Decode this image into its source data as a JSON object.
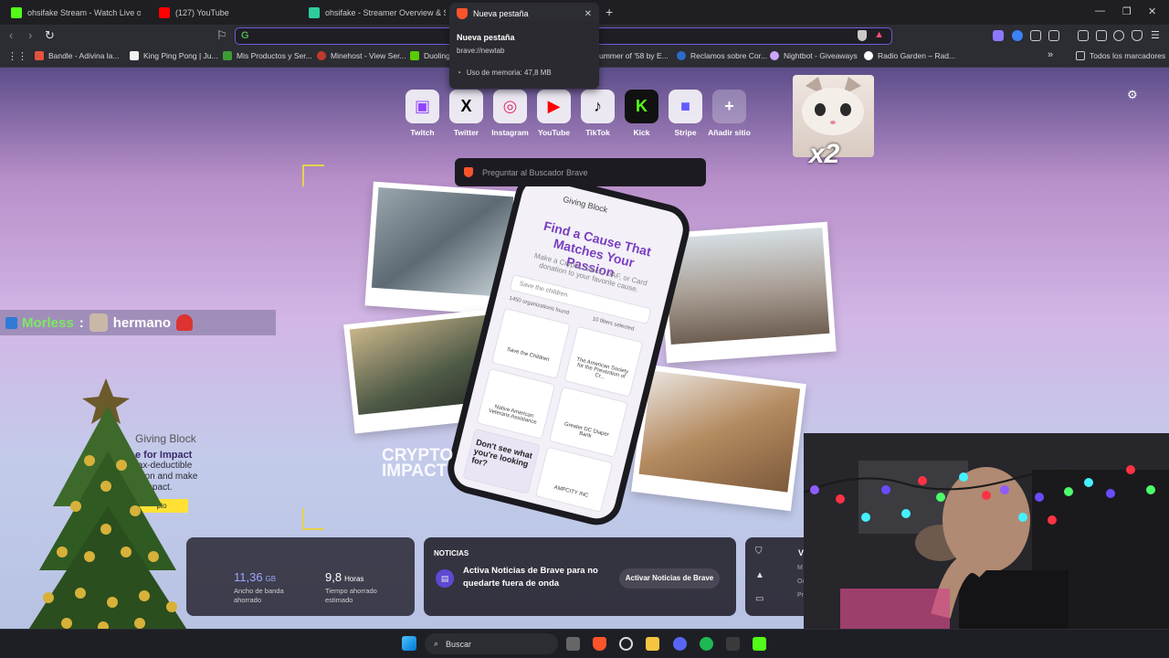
{
  "tabs": [
    {
      "title": "ohsifake Stream - Watch Live on",
      "color": "#53fc18"
    },
    {
      "title": "(127) YouTube",
      "color": "#ff0000"
    },
    {
      "title": "ohsifake - Streamer Overview & Stats",
      "color": "#2fcc9e"
    },
    {
      "title": "Nueva pestaña",
      "color": "#fb542b",
      "active": true
    }
  ],
  "hover_card": {
    "title": "Nueva pestaña",
    "url": "brave://newtab",
    "memory": "Uso de memoria: 47,8 MB"
  },
  "bookmarks": [
    {
      "label": "Bandle - Adivina la...",
      "color": "#e5533c"
    },
    {
      "label": "King Ping Pong | Ju...",
      "color": "#f1f1f1"
    },
    {
      "label": "Mis Productos y Ser...",
      "color": "#3e9b36"
    },
    {
      "label": "Minehost - View Ser...",
      "color": "#c0392b"
    },
    {
      "label": "Duoling",
      "color": "#58cc02"
    },
    {
      "label": "ummer of '58 by E...",
      "color": "#888888"
    },
    {
      "label": "Reclamos sobre Cor...",
      "color": "#2d6ac9"
    },
    {
      "label": "Nightbot - Giveaways",
      "color": "#c9a6ff"
    },
    {
      "label": "Radio Garden – Rad...",
      "color": "#ffffff"
    },
    {
      "label": "Todos los marcadores",
      "color": "#cccccc"
    }
  ],
  "top_sites": [
    {
      "label": "Twitch",
      "glyph": "▣",
      "color": "#9146ff"
    },
    {
      "label": "Twitter",
      "glyph": "X",
      "color": "#000000"
    },
    {
      "label": "Instagram",
      "glyph": "◎",
      "color": "#e1306c"
    },
    {
      "label": "YouTube",
      "glyph": "▶",
      "color": "#ff0000"
    },
    {
      "label": "TikTok",
      "glyph": "♪",
      "color": "#111111"
    },
    {
      "label": "Kick",
      "glyph": "K",
      "color": "#53fc18"
    },
    {
      "label": "Stripe",
      "glyph": "■",
      "color": "#635bff"
    },
    {
      "label": "Añadir sitio",
      "glyph": "+",
      "color": "#ffffff"
    }
  ],
  "search_prompt": "Preguntar al Buscador Brave",
  "chat": {
    "user": "Morless",
    "separator": ":",
    "message": "hermano"
  },
  "overlay": {
    "multiplier": "x2"
  },
  "sponsor": {
    "brand": "Giving Block",
    "headline": "e for Impact",
    "body1": "tax-deductible",
    "body2": "ation and make",
    "body3": "d impact.",
    "cta": "pto"
  },
  "phone_ad": {
    "headline": "Find a Cause That Matches Your Passion",
    "sub": "Make a Crypto, Stock, DAF, or Card donation to your favorite cause.",
    "search": "Save the children",
    "count": "1450 organizations found",
    "filters": "10 filters selected",
    "orgs": [
      "Save the Children",
      "The American Society for the Prevention of Cr...",
      "Native American Veterans Assistance",
      "Greater DC Diaper Bank",
      "AMPCITY INC"
    ],
    "cta": "Don't see what you're looking for?"
  },
  "crypto_impact": [
    "CRYPTO",
    "IMPACT"
  ],
  "stats": {
    "bandwidth_value": "11,36",
    "bandwidth_unit": "GB",
    "bandwidth_label": "Ancho de banda ahorrado",
    "time_value": "9,8",
    "time_unit": "Horas",
    "time_label": "Tiempo ahorrado estimado"
  },
  "news": {
    "heading": "NOTICIAS",
    "text": "Activa Noticias de Brave para no quedarte fuera de onda",
    "button": "Activar Noticias de Brave"
  },
  "vpn_widget": {
    "v": "V",
    "lines": [
      "M",
      "Ou",
      "Pr"
    ]
  },
  "taskbar": {
    "search": "Buscar"
  }
}
